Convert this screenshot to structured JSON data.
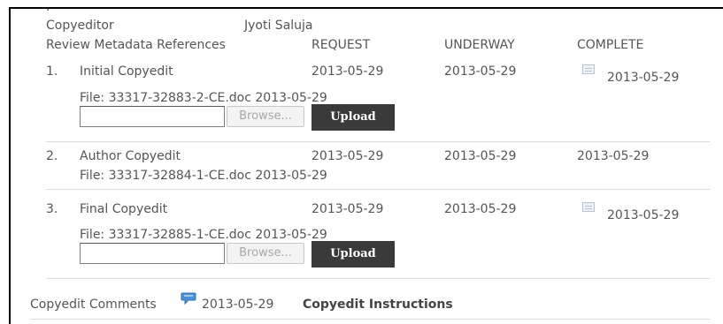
{
  "assignment": {
    "role_label": "Copyeditor",
    "assignee": "Jyoti Saluja"
  },
  "table": {
    "header": {
      "review_metadata_references": "Review Metadata References",
      "request": "REQUEST",
      "underway": "UNDERWAY",
      "complete": "COMPLETE"
    },
    "rows": [
      {
        "number": "1.",
        "name": "Initial Copyedit",
        "request": "2013-05-29",
        "underway": "2013-05-29",
        "complete": "2013-05-29",
        "file": "File: 33317-32883-2-CE.doc 2013-05-29",
        "browse_label": "Browse...",
        "upload_label": "Upload"
      },
      {
        "number": "2.",
        "name": "Author Copyedit",
        "request": "2013-05-29",
        "underway": "2013-05-29",
        "complete": "2013-05-29",
        "file": "File: 33317-32884-1-CE.doc 2013-05-29"
      },
      {
        "number": "3.",
        "name": "Final Copyedit",
        "request": "2013-05-29",
        "underway": "2013-05-29",
        "complete": "2013-05-29",
        "file": "File: 33317-32885-1-CE.doc 2013-05-29",
        "browse_label": "Browse...",
        "upload_label": "Upload"
      }
    ]
  },
  "footer": {
    "comments_label": "Copyedit Comments",
    "comments_date": "2013-05-29",
    "instructions_link": "Copyedit Instructions"
  },
  "colors": {
    "text": "#555555",
    "upload_button_bg": "#3a3a3a",
    "divider": "#dcdcdc",
    "comment_icon": "#4a90d9"
  }
}
